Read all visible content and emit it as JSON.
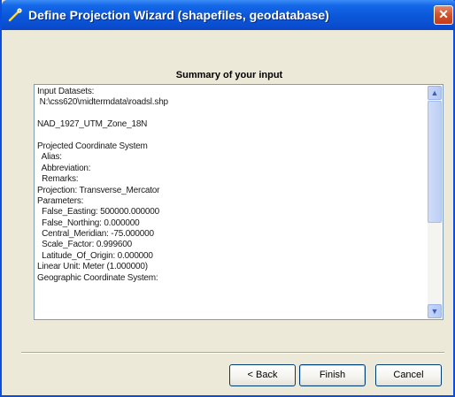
{
  "window": {
    "title": "Define Projection Wizard (shapefiles, geodatabase)",
    "close_glyph": "✕"
  },
  "summary": {
    "heading": "Summary of your input",
    "lines": [
      "Input Datasets:",
      " N:\\css620\\midtermdata\\roadsl.shp",
      "",
      "NAD_1927_UTM_Zone_18N",
      "",
      "Projected Coordinate System",
      "  Alias:",
      "  Abbreviation:",
      "  Remarks:",
      "Projection: Transverse_Mercator",
      "Parameters:",
      "  False_Easting: 500000.000000",
      "  False_Northing: 0.000000",
      "  Central_Meridian: -75.000000",
      "  Scale_Factor: 0.999600",
      "  Latitude_Of_Origin: 0.000000",
      "Linear Unit: Meter (1.000000)",
      "Geographic Coordinate System:"
    ],
    "scroll_up_glyph": "▲",
    "scroll_down_glyph": "▼"
  },
  "buttons": {
    "back": "< Back",
    "finish": "Finish",
    "cancel": "Cancel"
  },
  "icons": {
    "app": "wizard-wand-icon",
    "close": "close-icon"
  },
  "colors": {
    "titlebar": "#0a57d8",
    "close": "#d2502a",
    "dialog": "#ece9d8"
  }
}
